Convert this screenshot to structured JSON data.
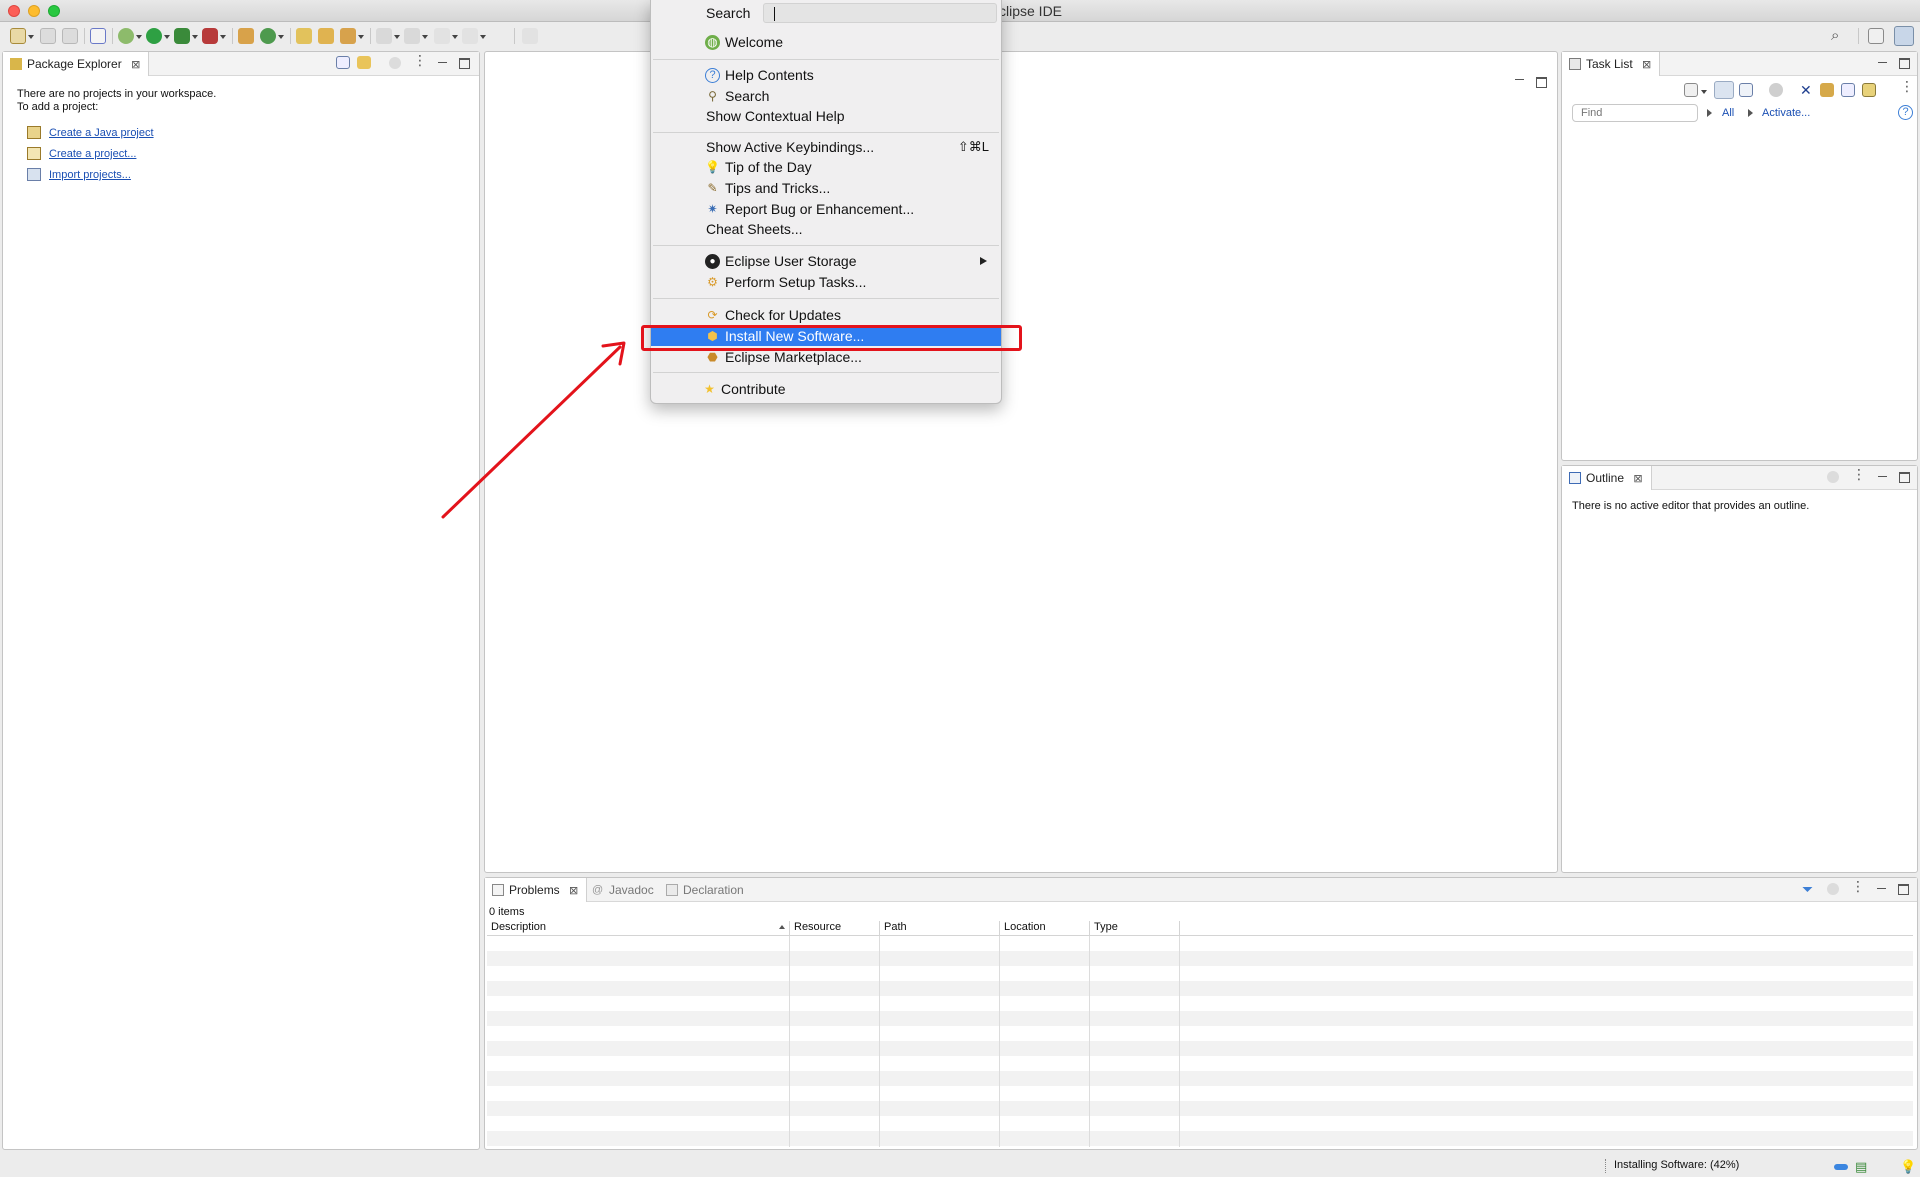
{
  "window": {
    "title": "clipse IDE"
  },
  "toolbar": {
    "icons": [
      "new-icon",
      "save-icon",
      "save-all-icon",
      "skip-breakpoints-icon",
      "debug-icon",
      "run-icon",
      "coverage-icon",
      "external-tools-icon",
      "new-java-package-icon",
      "new-java-class-icon",
      "open-type-icon",
      "open-task-icon",
      "search-icon",
      "next-annotation-icon",
      "previous-annotation-icon",
      "back-icon",
      "forward-icon",
      "pin-editor-icon"
    ],
    "right_icons": [
      "search-icon",
      "open-perspective-icon",
      "java-perspective-icon"
    ]
  },
  "package_explorer": {
    "tab_label": "Package Explorer",
    "message_line1": "There are no projects in your workspace.",
    "message_line2": "To add a project:",
    "links": [
      {
        "label": "Create a Java project",
        "icon": "java-project-icon"
      },
      {
        "label": "Create a project...",
        "icon": "project-icon"
      },
      {
        "label": "Import projects...",
        "icon": "import-icon"
      }
    ]
  },
  "task_list": {
    "tab_label": "Task List",
    "find_placeholder": "Find",
    "filter_all": "All",
    "activate": "Activate..."
  },
  "outline": {
    "tab_label": "Outline",
    "message": "There is no active editor that provides an outline."
  },
  "problems": {
    "tabs": [
      {
        "label": "Problems",
        "active": true
      },
      {
        "label": "Javadoc",
        "active": false
      },
      {
        "label": "Declaration",
        "active": false
      }
    ],
    "item_count": "0 items",
    "columns": [
      "Description",
      "Resource",
      "Path",
      "Location",
      "Type"
    ]
  },
  "status_bar": {
    "text": "Installing Software: (42%)"
  },
  "help_menu": {
    "search_label": "Search",
    "items": [
      {
        "label": "Welcome",
        "icon": "welcome-icon"
      },
      {
        "label": "Help Contents",
        "icon": "help-contents-icon"
      },
      {
        "label": "Search",
        "icon": "search-help-icon"
      },
      {
        "label": "Show Contextual Help",
        "icon": ""
      },
      {
        "label": "Show Active Keybindings...",
        "icon": "",
        "shortcut": "⇧⌘L"
      },
      {
        "label": "Tip of the Day",
        "icon": "lightbulb-icon"
      },
      {
        "label": "Tips and Tricks...",
        "icon": "tips-icon"
      },
      {
        "label": "Report Bug or Enhancement...",
        "icon": "bug-icon"
      },
      {
        "label": "Cheat Sheets...",
        "icon": ""
      },
      {
        "label": "Eclipse User Storage",
        "icon": "user-icon",
        "submenu": true
      },
      {
        "label": "Perform Setup Tasks...",
        "icon": "setup-icon"
      },
      {
        "label": "Check for Updates",
        "icon": "update-icon"
      },
      {
        "label": "Install New Software...",
        "icon": "install-icon",
        "selected": true
      },
      {
        "label": "Eclipse Marketplace...",
        "icon": "marketplace-icon"
      },
      {
        "label": "Contribute",
        "icon": "star-icon"
      }
    ]
  },
  "colors": {
    "menu_selection": "#2f7df1",
    "annotation_red": "#e3131b",
    "link_blue": "#1a4fb3"
  }
}
